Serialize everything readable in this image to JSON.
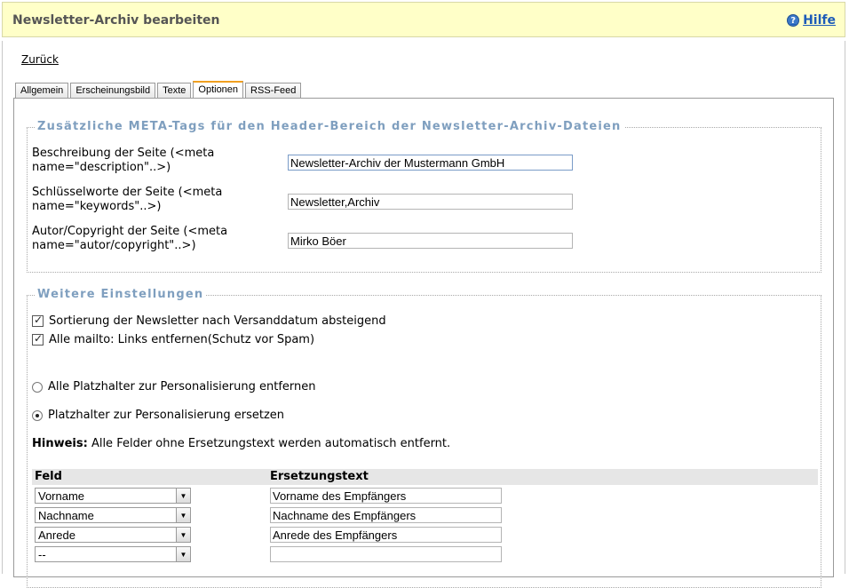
{
  "header": {
    "title": "Newsletter-Archiv bearbeiten",
    "help_label": "Hilfe",
    "help_icon": "?"
  },
  "back_link": "Zurück",
  "tabs": [
    {
      "label": "Allgemein"
    },
    {
      "label": "Erscheinungsbild"
    },
    {
      "label": "Texte"
    },
    {
      "label": "Optionen"
    },
    {
      "label": "RSS-Feed"
    }
  ],
  "active_tab": "Optionen",
  "meta_section": {
    "legend": "Zusätzliche META-Tags für den Header-Bereich der Newsletter-Archiv-Dateien",
    "fields": [
      {
        "label": "Beschreibung der Seite (<meta name=\"description\"..>)",
        "value": "Newsletter-Archiv der Mustermann GmbH"
      },
      {
        "label": "Schlüsselworte der Seite (<meta name=\"keywords\"..>)",
        "value": "Newsletter,Archiv"
      },
      {
        "label": "Autor/Copyright der Seite (<meta name=\"autor/copyright\"..>)",
        "value": "Mirko Böer"
      }
    ]
  },
  "settings_section": {
    "legend": "Weitere Einstellungen",
    "checkboxes": [
      {
        "label": "Sortierung der Newsletter nach Versanddatum absteigend",
        "checked": true
      },
      {
        "label": "Alle mailto: Links entfernen(Schutz vor Spam)",
        "checked": true
      }
    ],
    "radios": [
      {
        "label": "Alle Platzhalter zur Personalisierung entfernen",
        "selected": false
      },
      {
        "label": "Platzhalter zur Personalisierung ersetzen",
        "selected": true
      }
    ],
    "hint_bold": "Hinweis:",
    "hint_text": " Alle Felder ohne Ersetzungstext werden automatisch entfernt.",
    "table": {
      "col_field": "Feld",
      "col_replacement": "Ersetzungstext",
      "rows": [
        {
          "field": "Vorname",
          "replacement": "Vorname des Empfängers"
        },
        {
          "field": "Nachname",
          "replacement": "Nachname des Empfängers"
        },
        {
          "field": "Anrede",
          "replacement": "Anrede des Empfängers"
        },
        {
          "field": "--",
          "replacement": ""
        }
      ]
    }
  },
  "colors": {
    "header_bg": "#ffffc8",
    "legend": "#7f9fbf",
    "link": "#1d5bb8",
    "active_tab_accent": "#f0a020"
  },
  "icons": {
    "help": "help-icon",
    "dropdown": "chevron-down-icon",
    "check": "check-icon"
  }
}
